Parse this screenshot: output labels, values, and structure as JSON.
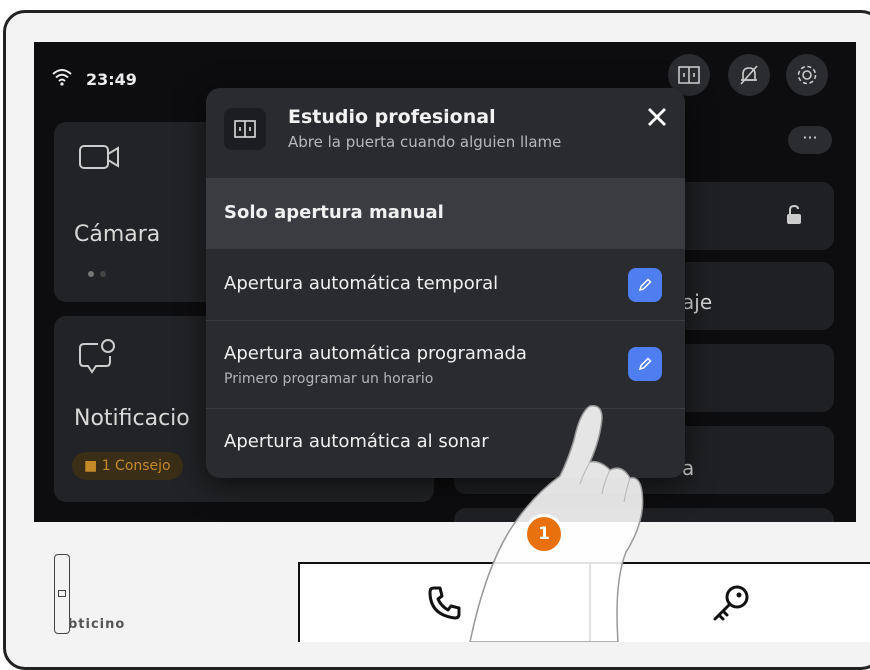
{
  "status": {
    "time": "23:49"
  },
  "icons": {
    "wifi": "wifi-icon",
    "door": "door-icon",
    "bell_off": "bell-off-icon",
    "settings": "gear-icon",
    "camera": "camera-icon",
    "notifications": "notification-bubble-icon",
    "lock": "unlock-icon",
    "phone": "phone-icon",
    "key": "key-icon"
  },
  "dashboard": {
    "camera_label": "Cámara",
    "notifications_label": "Notificacio",
    "notifications_badge": "1 Consejo",
    "right_partial_1": "aje",
    "right_partial_2": "a"
  },
  "modal": {
    "title": "Estudio profesional",
    "subtitle": "Abre la puerta cuando alguien llame",
    "options": [
      {
        "label": "Solo apertura manual",
        "selected": true
      },
      {
        "label": "Apertura automática temporal",
        "editable": true
      },
      {
        "label": "Apertura automática programada",
        "sublabel": "Primero programar un horario",
        "editable": true
      },
      {
        "label": "Apertura automática al sonar"
      }
    ]
  },
  "device": {
    "brand": "bticino"
  },
  "callout": {
    "step": "1"
  },
  "colors": {
    "accent": "#4f7ef0",
    "badge": "#e8710d",
    "screen_bg": "#0d0d0f",
    "modal_bg": "#2a2b2f"
  }
}
